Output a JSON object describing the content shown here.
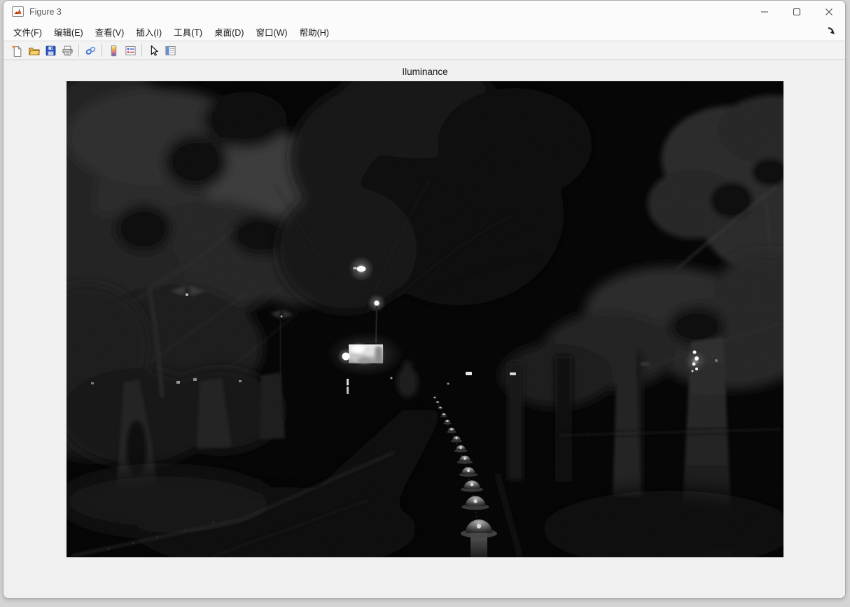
{
  "window": {
    "title": "Figure 3",
    "controls": [
      {
        "name": "minimize"
      },
      {
        "name": "maximize"
      },
      {
        "name": "close"
      }
    ]
  },
  "menu_bar": {
    "items": [
      {
        "label": "文件(F)"
      },
      {
        "label": "编辑(E)"
      },
      {
        "label": "查看(V)"
      },
      {
        "label": "插入(I)"
      },
      {
        "label": "工具(T)"
      },
      {
        "label": "桌面(D)"
      },
      {
        "label": "窗口(W)"
      },
      {
        "label": "帮助(H)"
      }
    ],
    "dock_icon": "dock-figure-arrow"
  },
  "toolbar": {
    "icons": [
      "new-figure",
      "open-file",
      "save-figure",
      "print-figure",
      "link-plot",
      "insert-colorbar",
      "insert-legend",
      "edit-plot",
      "open-property-inspector"
    ]
  },
  "figure": {
    "plot_title": "Iluminance",
    "image": {
      "type": "grayscale-night-photo",
      "description": "Dark nighttime park scene: tree canopies upper-left and right, street-lamp silhouettes, one bright lamp point, a small glowing sign left of center, sparkle of light through leaves on the right, and a curved row of dome-topped reflective bollards receding along a dark walkway toward the bottom of the frame."
    }
  },
  "colors": {
    "chrome_bg": "#fbfbfb",
    "toolbar_bg": "#f3f3f3",
    "figure_bg": "#f0f0f0",
    "image_bg": "#040404",
    "desktop_bg": "#d4d4d4"
  }
}
